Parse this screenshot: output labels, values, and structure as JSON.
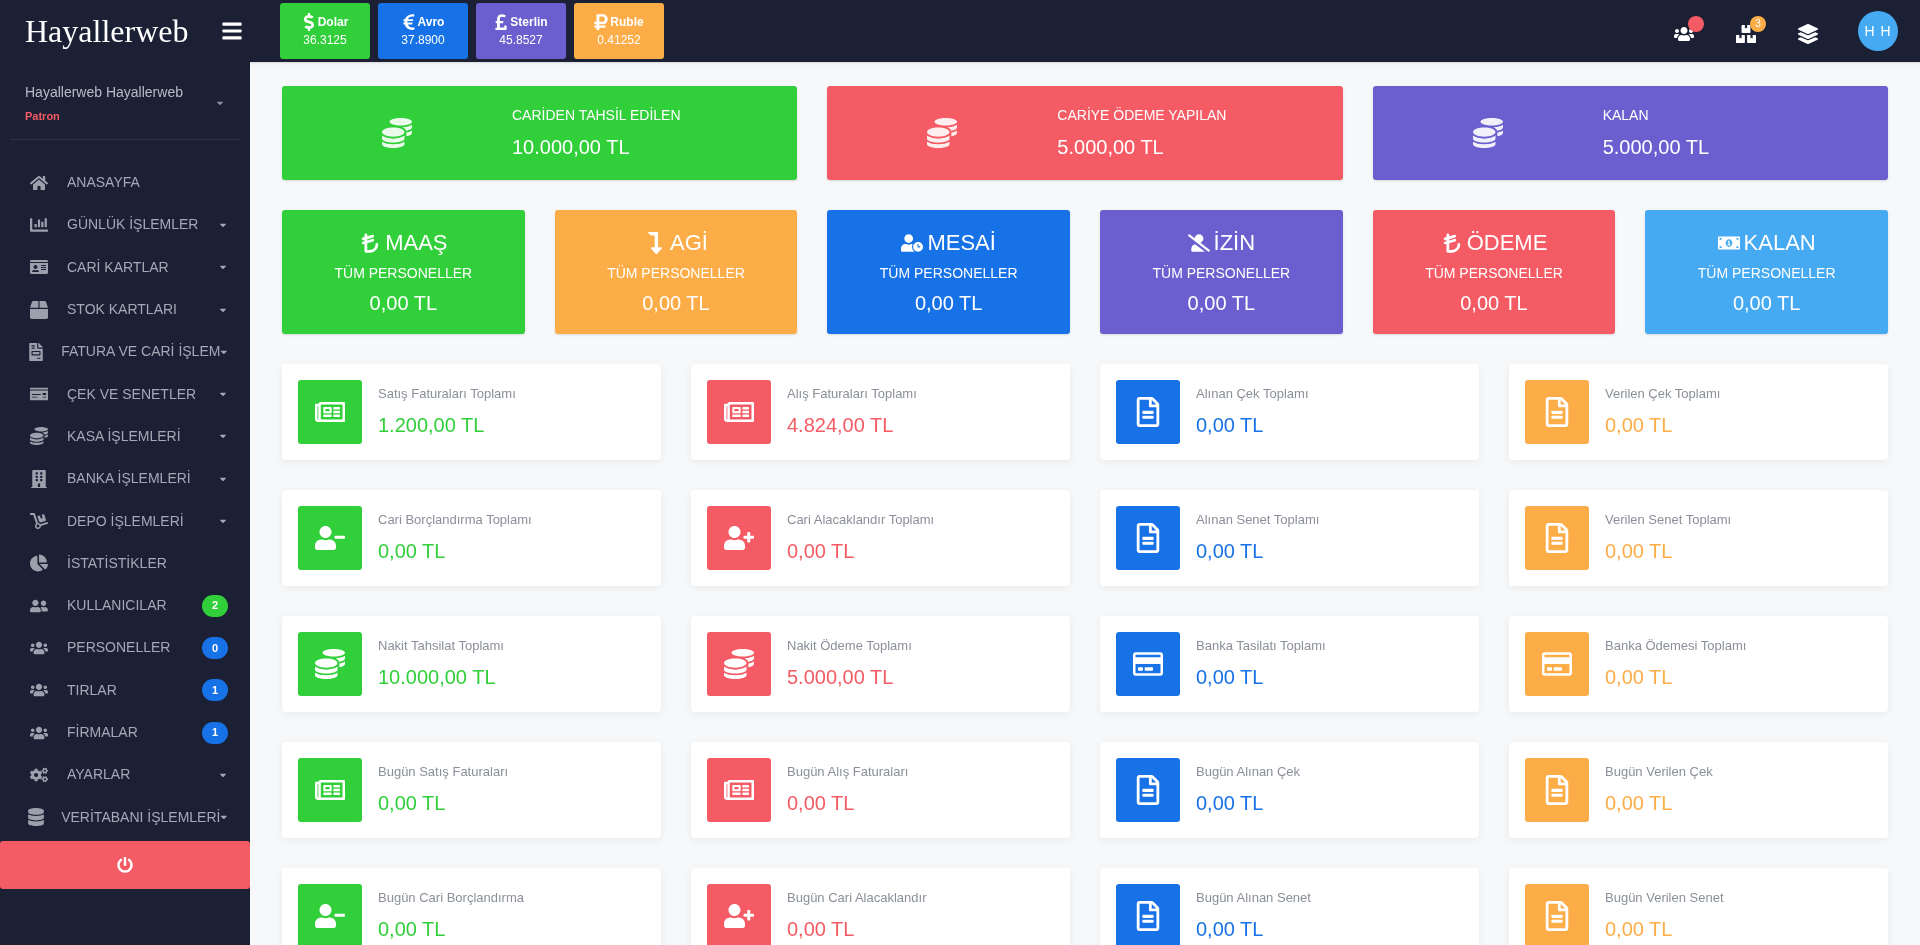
{
  "brand": "Hayallerweb",
  "currencies": [
    {
      "kind": "dollar",
      "name": "Dolar",
      "rate": "36.3125",
      "color": "#31cf3a"
    },
    {
      "kind": "euro",
      "name": "Avro",
      "rate": "37.8900",
      "color": "#1672e6"
    },
    {
      "kind": "pound",
      "name": "Sterlin",
      "rate": "45.8527",
      "color": "#6b5fcf"
    },
    {
      "kind": "ruble",
      "name": "Ruble",
      "rate": "0.41252",
      "color": "#fdad47"
    }
  ],
  "header_icons": [
    {
      "kind": "users",
      "dot": true
    },
    {
      "kind": "boxes",
      "dot": false,
      "badge": "3"
    },
    {
      "kind": "layers",
      "dot": false
    }
  ],
  "avatar": "H H",
  "user": {
    "name": "Hayallerweb Hayallerweb",
    "role": "Patron"
  },
  "sidebar": {
    "items": [
      {
        "kind": "home",
        "label": "ANASAYFA",
        "submenu": false
      },
      {
        "kind": "chart",
        "label": "GÜNLÜK İŞLEMLER",
        "submenu": true
      },
      {
        "kind": "card",
        "label": "CARİ KARTLAR",
        "submenu": true
      },
      {
        "kind": "box",
        "label": "STOK KARTLARI",
        "submenu": true
      },
      {
        "kind": "file",
        "label": "FATURA VE CARİ İŞLEM",
        "submenu": true
      },
      {
        "kind": "cheque",
        "label": "ÇEK VE SENETLER",
        "submenu": true
      },
      {
        "kind": "coins",
        "label": "KASA İŞLEMLERİ",
        "submenu": true
      },
      {
        "kind": "building",
        "label": "BANKA İŞLEMLERİ",
        "submenu": true
      },
      {
        "kind": "dolly",
        "label": "DEPO İŞLEMLERİ",
        "submenu": true
      },
      {
        "kind": "pie",
        "label": "İSTATİSTİKLER",
        "submenu": false
      },
      {
        "kind": "user-friends",
        "label": "KULLANICILAR",
        "submenu": false,
        "badge": "2",
        "color": "#31cf3a"
      },
      {
        "kind": "users",
        "label": "PERSONELLER",
        "submenu": false,
        "badge": "0",
        "color": "#1672e6"
      },
      {
        "kind": "users",
        "label": "TIRLAR",
        "submenu": false,
        "badge": "1",
        "color": "#1672e6"
      },
      {
        "kind": "users",
        "label": "FİRMALAR",
        "submenu": false,
        "badge": "1",
        "color": "#1672e6"
      },
      {
        "kind": "cogs",
        "label": "AYARLAR",
        "submenu": true
      },
      {
        "kind": "database",
        "label": "VERİTABANI İŞLEMLERİ",
        "submenu": true
      }
    ]
  },
  "summary": [
    {
      "title": "CARİDEN TAHSİL EDİLEN",
      "value": "10.000,00 TL",
      "color": "#31cf3a"
    },
    {
      "title": "CARİYE ÖDEME YAPILAN",
      "value": "5.000,00 TL",
      "color": "#f45b64"
    },
    {
      "title": "KALAN",
      "value": "5.000,00 TL",
      "color": "#6b5fcf"
    }
  ],
  "personnel": [
    {
      "kind": "lira",
      "title": "MAAŞ",
      "subtitle": "TÜM PERSONELLER",
      "value": "0,00 TL",
      "color": "#31cf3a"
    },
    {
      "kind": "arrow",
      "title": "AGİ",
      "subtitle": "TÜM PERSONELLER",
      "value": "0,00 TL",
      "color": "#fdad47"
    },
    {
      "kind": "clock",
      "title": "MESAİ",
      "subtitle": "TÜM PERSONELLER",
      "value": "0,00 TL",
      "color": "#1672e6"
    },
    {
      "kind": "slash",
      "title": "İZİN",
      "subtitle": "TÜM PERSONELLER",
      "value": "0,00 TL",
      "color": "#6b5fcf"
    },
    {
      "kind": "lira",
      "title": "ÖDEME",
      "subtitle": "TÜM PERSONELLER",
      "value": "0,00 TL",
      "color": "#f45b64"
    },
    {
      "kind": "money",
      "title": "KALAN",
      "subtitle": "TÜM PERSONELLER",
      "value": "0,00 TL",
      "color": "#45aaf2"
    }
  ],
  "stats": [
    {
      "kind": "newspaper",
      "label": "Satış Faturaları Toplamı",
      "value": "1.200,00 TL",
      "color": "#31cf3a"
    },
    {
      "kind": "newspaper",
      "label": "Alış Faturaları Toplamı",
      "value": "4.824,00 TL",
      "color": "#f45b64"
    },
    {
      "kind": "document",
      "label": "Alınan Çek Toplamı",
      "value": "0,00 TL",
      "color": "#1672e6"
    },
    {
      "kind": "document",
      "label": "Verilen Çek Toplamı",
      "value": "0,00 TL",
      "color": "#fdad47"
    },
    {
      "kind": "user-minus",
      "label": "Cari Borçlandırma Toplamı",
      "value": "0,00 TL",
      "color": "#31cf3a"
    },
    {
      "kind": "user-plus",
      "label": "Cari Alacaklandır Toplamı",
      "value": "0,00 TL",
      "color": "#f45b64"
    },
    {
      "kind": "document",
      "label": "Alınan Senet Toplamı",
      "value": "0,00 TL",
      "color": "#1672e6"
    },
    {
      "kind": "document",
      "label": "Verilen Senet Toplamı",
      "value": "0,00 TL",
      "color": "#fdad47"
    },
    {
      "kind": "coins",
      "label": "Nakit Tahsilat Toplamı",
      "value": "10.000,00 TL",
      "color": "#31cf3a"
    },
    {
      "kind": "coins",
      "label": "Nakit Ödeme Toplamı",
      "value": "5.000,00 TL",
      "color": "#f45b64"
    },
    {
      "kind": "credit-card",
      "label": "Banka Tasilatı Toplamı",
      "value": "0,00 TL",
      "color": "#1672e6"
    },
    {
      "kind": "credit-card",
      "label": "Banka Ödemesi Toplamı",
      "value": "0,00 TL",
      "color": "#fdad47"
    },
    {
      "kind": "newspaper",
      "label": "Bugün Satış Faturaları",
      "value": "0,00 TL",
      "color": "#31cf3a"
    },
    {
      "kind": "newspaper",
      "label": "Bugün Alış Faturaları",
      "value": "0,00 TL",
      "color": "#f45b64"
    },
    {
      "kind": "document",
      "label": "Bugün Alınan Çek",
      "value": "0,00 TL",
      "color": "#1672e6"
    },
    {
      "kind": "document",
      "label": "Bugün Verilen Çek",
      "value": "0,00 TL",
      "color": "#fdad47"
    },
    {
      "kind": "user-minus",
      "label": "Bugün Cari Borçlandırma",
      "value": "0,00 TL",
      "color": "#31cf3a"
    },
    {
      "kind": "user-plus",
      "label": "Bugün Cari Alacaklandır",
      "value": "0,00 TL",
      "color": "#f45b64"
    },
    {
      "kind": "document",
      "label": "Bugün Alınan Senet",
      "value": "0,00 TL",
      "color": "#1672e6"
    },
    {
      "kind": "document",
      "label": "Bugün Verilen Senet",
      "value": "0,00 TL",
      "color": "#fdad47"
    }
  ]
}
